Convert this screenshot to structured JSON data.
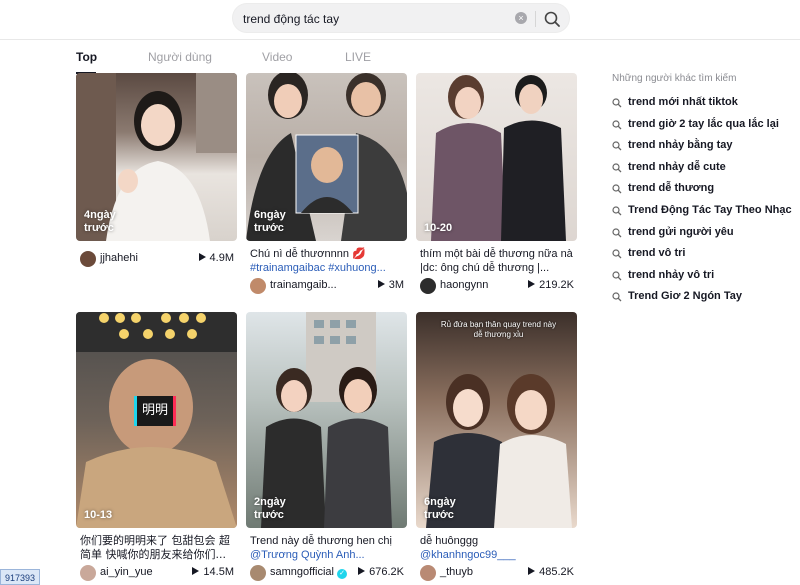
{
  "search": {
    "value": "trend động tác tay",
    "clear_glyph": "×"
  },
  "tabs": [
    {
      "label": "Top",
      "active": true
    },
    {
      "label": "Người dùng",
      "active": false
    },
    {
      "label": "Video",
      "active": false
    },
    {
      "label": "LIVE",
      "active": false
    }
  ],
  "videos": [
    {
      "time": "4ngày\ntrước",
      "caption": "",
      "hashtags": "",
      "user": "jjhahehi",
      "views": "4.9M",
      "avatar_color": "#6b4a3a"
    },
    {
      "time": "6ngày\ntrước",
      "caption": "Chú nì dễ thươnnnn 💋",
      "hashtags": "#trainamgaibac #xuhuong...",
      "user": "trainamgaib...",
      "views": "3M",
      "avatar_color": "#c08a6a"
    },
    {
      "time": "10-20",
      "caption": "thím một bài dễ thương nữa nà |dc: ông chú dễ thương |...",
      "hashtags": "",
      "user": "haongynn",
      "views": "219.2K",
      "avatar_color": "#2c2c2c"
    },
    {
      "time": "10-13",
      "caption": "你们要的明明来了 包甜包会 超简单 快喊你的朋友来给你们...",
      "hashtags": "",
      "user": "ai_yin_yue",
      "views": "14.5M",
      "avatar_color": "#c9a89a"
    },
    {
      "time": "2ngày\ntrước",
      "caption": "Trend này dễ thương hen chị",
      "hashtags": "@Trương Quỳnh Anh...",
      "user": "samngofficial",
      "views": "676.2K",
      "avatar_color": "#a88a70"
    },
    {
      "time": "6ngày\ntrước",
      "caption": "dễ huônggg",
      "hashtags": "@khanhngoc99___",
      "user": "_thuyb",
      "views": "485.2K",
      "avatar_color": "#b98a74"
    }
  ],
  "overlay_texts": {
    "card4_label": "明明",
    "card6_caption_overlay": "Rủ đứa bạn thân quay trend này dễ thương xỉu"
  },
  "side": {
    "title": "Những người khác tìm kiếm",
    "items": [
      "trend mới nhất tiktok",
      "trend giờ 2 tay lắc qua lắc lại",
      "trend nhảy bằng tay",
      "trend nhảy dễ cute",
      "trend dễ thương",
      "Trend Động Tác Tay Theo Nhạc",
      "trend gửi người yêu",
      "trend vô tri",
      "trend nhảy vô tri",
      "Trend Giơ 2 Ngón Tay"
    ]
  },
  "badge": "917393",
  "colors": {
    "accent_link": "#2b5db8",
    "verified": "#20d5ec"
  }
}
